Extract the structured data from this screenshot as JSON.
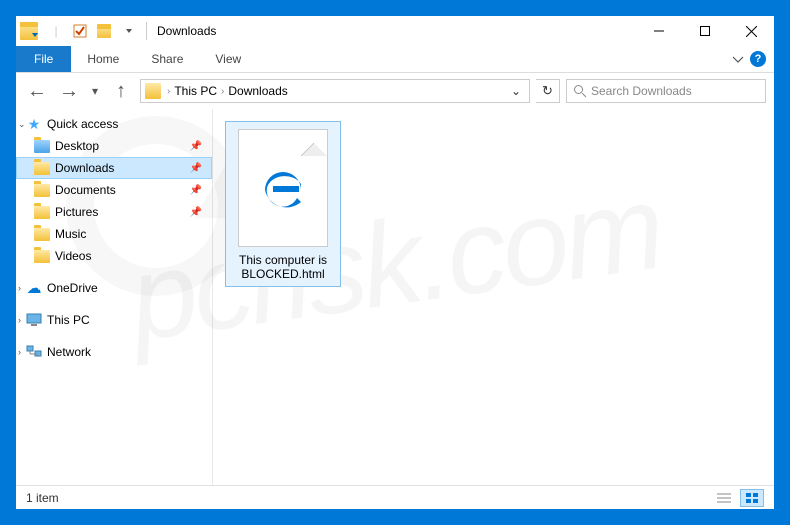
{
  "titlebar": {
    "title": "Downloads"
  },
  "ribbon": {
    "file": "File",
    "tabs": [
      "Home",
      "Share",
      "View"
    ]
  },
  "breadcrumb": {
    "segments": [
      "This PC",
      "Downloads"
    ]
  },
  "search": {
    "placeholder": "Search Downloads"
  },
  "sidebar": {
    "quick_access": {
      "label": "Quick access",
      "items": [
        {
          "label": "Desktop",
          "pinned": true
        },
        {
          "label": "Downloads",
          "pinned": true,
          "selected": true
        },
        {
          "label": "Documents",
          "pinned": true
        },
        {
          "label": "Pictures",
          "pinned": true
        },
        {
          "label": "Music",
          "pinned": false
        },
        {
          "label": "Videos",
          "pinned": false
        }
      ]
    },
    "onedrive": {
      "label": "OneDrive"
    },
    "this_pc": {
      "label": "This PC"
    },
    "network": {
      "label": "Network"
    }
  },
  "files": [
    {
      "name": "This computer is BLOCKED.html",
      "selected": true,
      "icon": "edge"
    }
  ],
  "statusbar": {
    "count_text": "1 item"
  },
  "watermark": "pcrisk.com"
}
